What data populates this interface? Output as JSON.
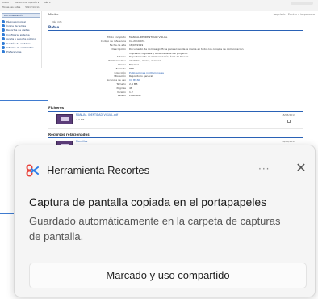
{
  "browser": {
    "tabs": [
      "Inicio ▾",
      "Acerca de Opción ▾",
      "Más ▾"
    ],
    "address": "Todas las rutas",
    "path_label": "Wiki / Inicio"
  },
  "sidebar": {
    "title": "Documentación",
    "items": [
      "Página principal",
      "Índice de temas",
      "Reportes de visitas",
      "Configurar sistema",
      "Ayuda y soporte público",
      "Gestión de archivos",
      "Informe de contenidos",
      "Preferencias"
    ]
  },
  "main": {
    "breadcrumb": "Mi sitio",
    "header_right": "Imprimir · Enviar a impresora",
    "sub_breadcrumb": "Más info",
    "section_title": "Datos",
    "fields": [
      {
        "k": "Título completo",
        "v": "MANUAL DE IDENTIDAD VISUAL"
      },
      {
        "k": "Código de referencia",
        "v": "CA-2019-031"
      },
      {
        "k": "Fecha de alta",
        "v": "18/03/2019"
      },
      {
        "k": "Descripción",
        "v": "Documento de normas gráficas para el uso de la marca en todos los canales de comunicación"
      },
      {
        "k": "",
        "v": "impresos, digitales y audiovisuales del proyecto."
      },
      {
        "k": "Autores",
        "v": "Departamento de Comunicación, Área de Diseño"
      },
      {
        "k": "Palabras clave",
        "v": "identidad, marca, manual"
      },
      {
        "k": "Idioma",
        "v": "Español"
      },
      {
        "k": "Formato",
        "v": "PDF"
      },
      {
        "k": "Colección",
        "v": "Publicaciones institucionales"
      },
      {
        "k": "Ubicación",
        "v": "Repositorio general"
      },
      {
        "k": "Licencia de uso",
        "v": "CC BY-NC"
      },
      {
        "k": "Tamaño",
        "v": "2,4 MB"
      },
      {
        "k": "Páginas",
        "v": "48"
      },
      {
        "k": "Versión",
        "v": "1.2"
      },
      {
        "k": "Estado",
        "v": "Publicado"
      }
    ],
    "attachments": {
      "title": "Ficheros",
      "name": "MANUAL_IDENTIDAD_VISUAL.pdf",
      "meta": "2,4 MB",
      "right": "18/03/2019"
    },
    "related": {
      "title": "Recursos relacionados",
      "name": "Plantillas",
      "meta": "Presentación corporativa",
      "right": "18/03/2019"
    }
  },
  "toast": {
    "app_name": "Herramienta Recortes",
    "more_label": "···",
    "close_label": "✕",
    "title": "Captura de pantalla copiada en el portapapeles",
    "body": "Guardado automáticamente en la carpeta de capturas de pantalla.",
    "action_label": "Marcado y uso compartido",
    "colors": {
      "icon_red": "#e8423a",
      "icon_blue": "#2b7de9",
      "background": "#f5f5f5"
    }
  }
}
